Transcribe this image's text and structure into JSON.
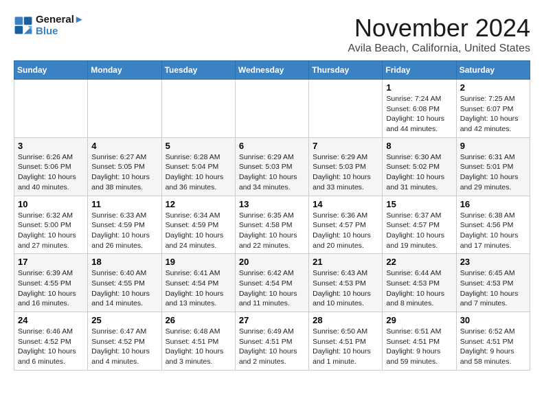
{
  "logo": {
    "line1": "General",
    "line2": "Blue"
  },
  "title": "November 2024",
  "location": "Avila Beach, California, United States",
  "weekdays": [
    "Sunday",
    "Monday",
    "Tuesday",
    "Wednesday",
    "Thursday",
    "Friday",
    "Saturday"
  ],
  "weeks": [
    [
      {
        "day": "",
        "info": ""
      },
      {
        "day": "",
        "info": ""
      },
      {
        "day": "",
        "info": ""
      },
      {
        "day": "",
        "info": ""
      },
      {
        "day": "",
        "info": ""
      },
      {
        "day": "1",
        "info": "Sunrise: 7:24 AM\nSunset: 6:08 PM\nDaylight: 10 hours\nand 44 minutes."
      },
      {
        "day": "2",
        "info": "Sunrise: 7:25 AM\nSunset: 6:07 PM\nDaylight: 10 hours\nand 42 minutes."
      }
    ],
    [
      {
        "day": "3",
        "info": "Sunrise: 6:26 AM\nSunset: 5:06 PM\nDaylight: 10 hours\nand 40 minutes."
      },
      {
        "day": "4",
        "info": "Sunrise: 6:27 AM\nSunset: 5:05 PM\nDaylight: 10 hours\nand 38 minutes."
      },
      {
        "day": "5",
        "info": "Sunrise: 6:28 AM\nSunset: 5:04 PM\nDaylight: 10 hours\nand 36 minutes."
      },
      {
        "day": "6",
        "info": "Sunrise: 6:29 AM\nSunset: 5:03 PM\nDaylight: 10 hours\nand 34 minutes."
      },
      {
        "day": "7",
        "info": "Sunrise: 6:29 AM\nSunset: 5:03 PM\nDaylight: 10 hours\nand 33 minutes."
      },
      {
        "day": "8",
        "info": "Sunrise: 6:30 AM\nSunset: 5:02 PM\nDaylight: 10 hours\nand 31 minutes."
      },
      {
        "day": "9",
        "info": "Sunrise: 6:31 AM\nSunset: 5:01 PM\nDaylight: 10 hours\nand 29 minutes."
      }
    ],
    [
      {
        "day": "10",
        "info": "Sunrise: 6:32 AM\nSunset: 5:00 PM\nDaylight: 10 hours\nand 27 minutes."
      },
      {
        "day": "11",
        "info": "Sunrise: 6:33 AM\nSunset: 4:59 PM\nDaylight: 10 hours\nand 26 minutes."
      },
      {
        "day": "12",
        "info": "Sunrise: 6:34 AM\nSunset: 4:59 PM\nDaylight: 10 hours\nand 24 minutes."
      },
      {
        "day": "13",
        "info": "Sunrise: 6:35 AM\nSunset: 4:58 PM\nDaylight: 10 hours\nand 22 minutes."
      },
      {
        "day": "14",
        "info": "Sunrise: 6:36 AM\nSunset: 4:57 PM\nDaylight: 10 hours\nand 20 minutes."
      },
      {
        "day": "15",
        "info": "Sunrise: 6:37 AM\nSunset: 4:57 PM\nDaylight: 10 hours\nand 19 minutes."
      },
      {
        "day": "16",
        "info": "Sunrise: 6:38 AM\nSunset: 4:56 PM\nDaylight: 10 hours\nand 17 minutes."
      }
    ],
    [
      {
        "day": "17",
        "info": "Sunrise: 6:39 AM\nSunset: 4:55 PM\nDaylight: 10 hours\nand 16 minutes."
      },
      {
        "day": "18",
        "info": "Sunrise: 6:40 AM\nSunset: 4:55 PM\nDaylight: 10 hours\nand 14 minutes."
      },
      {
        "day": "19",
        "info": "Sunrise: 6:41 AM\nSunset: 4:54 PM\nDaylight: 10 hours\nand 13 minutes."
      },
      {
        "day": "20",
        "info": "Sunrise: 6:42 AM\nSunset: 4:54 PM\nDaylight: 10 hours\nand 11 minutes."
      },
      {
        "day": "21",
        "info": "Sunrise: 6:43 AM\nSunset: 4:53 PM\nDaylight: 10 hours\nand 10 minutes."
      },
      {
        "day": "22",
        "info": "Sunrise: 6:44 AM\nSunset: 4:53 PM\nDaylight: 10 hours\nand 8 minutes."
      },
      {
        "day": "23",
        "info": "Sunrise: 6:45 AM\nSunset: 4:53 PM\nDaylight: 10 hours\nand 7 minutes."
      }
    ],
    [
      {
        "day": "24",
        "info": "Sunrise: 6:46 AM\nSunset: 4:52 PM\nDaylight: 10 hours\nand 6 minutes."
      },
      {
        "day": "25",
        "info": "Sunrise: 6:47 AM\nSunset: 4:52 PM\nDaylight: 10 hours\nand 4 minutes."
      },
      {
        "day": "26",
        "info": "Sunrise: 6:48 AM\nSunset: 4:51 PM\nDaylight: 10 hours\nand 3 minutes."
      },
      {
        "day": "27",
        "info": "Sunrise: 6:49 AM\nSunset: 4:51 PM\nDaylight: 10 hours\nand 2 minutes."
      },
      {
        "day": "28",
        "info": "Sunrise: 6:50 AM\nSunset: 4:51 PM\nDaylight: 10 hours\nand 1 minute."
      },
      {
        "day": "29",
        "info": "Sunrise: 6:51 AM\nSunset: 4:51 PM\nDaylight: 9 hours\nand 59 minutes."
      },
      {
        "day": "30",
        "info": "Sunrise: 6:52 AM\nSunset: 4:51 PM\nDaylight: 9 hours\nand 58 minutes."
      }
    ]
  ]
}
